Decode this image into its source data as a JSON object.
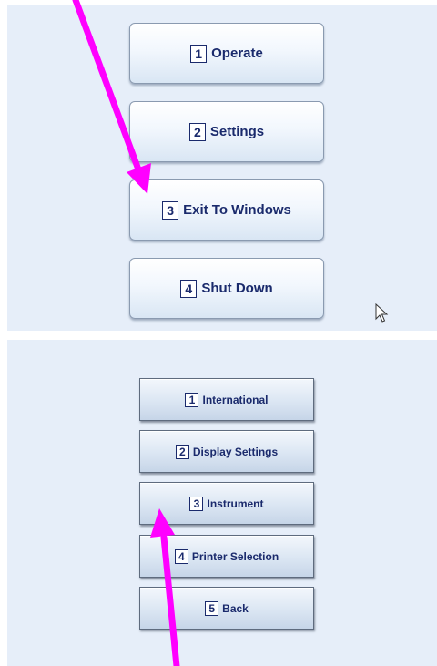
{
  "main_menu": {
    "buttons": [
      {
        "number": "1",
        "label": "Operate"
      },
      {
        "number": "2",
        "label": "Settings"
      },
      {
        "number": "3",
        "label": "Exit To Windows"
      },
      {
        "number": "4",
        "label": "Shut Down"
      }
    ]
  },
  "settings_menu": {
    "buttons": [
      {
        "number": "1",
        "label": "International"
      },
      {
        "number": "2",
        "label": "Display Settings"
      },
      {
        "number": "3",
        "label": "Instrument"
      },
      {
        "number": "4",
        "label": "Printer Selection"
      },
      {
        "number": "5",
        "label": "Back"
      }
    ]
  },
  "colors": {
    "panel_background": "#e6eef9",
    "button_text": "#1a2a6c",
    "annotation_arrow": "#ff00ff"
  },
  "icons": [
    "mouse-cursor-icon"
  ]
}
